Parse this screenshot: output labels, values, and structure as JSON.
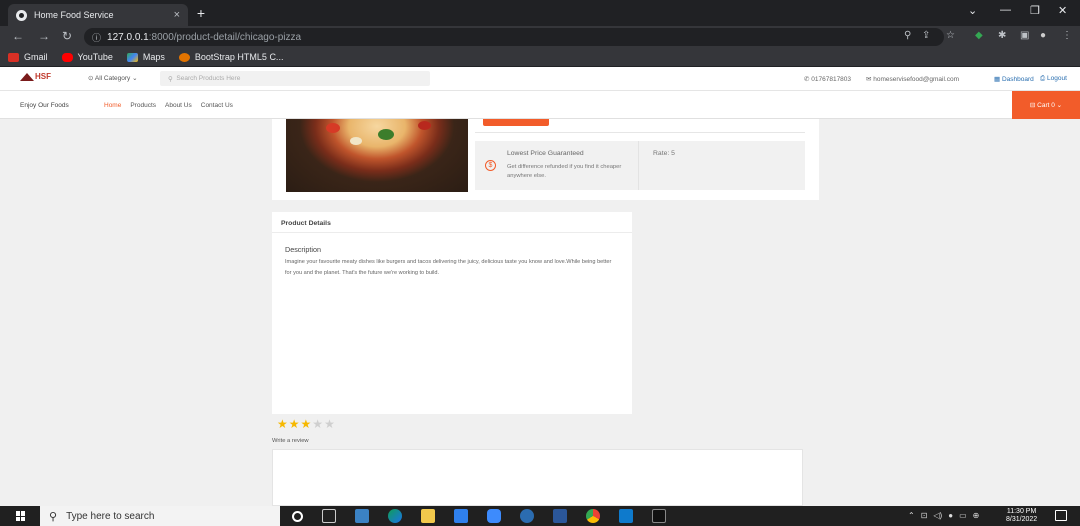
{
  "browser": {
    "tab_title": "Home Food Service",
    "tab_close": "×",
    "new_tab": "+",
    "url_host": "127.0.0.1",
    "url_rest": ":8000/product-detail/chicago-pizza",
    "bookmarks": [
      "Gmail",
      "YouTube",
      "Maps",
      "BootStrap HTML5 C..."
    ]
  },
  "site": {
    "logo_text": "HSF",
    "category_label": "All Category",
    "search_placeholder": "Search Products Here",
    "phone": "01767817803",
    "email": "homeservisefood@gmail.com",
    "dashboard": "Dashboard",
    "logout": "Logout",
    "tagline": "Enjoy Our Foods",
    "nav": [
      "Home",
      "Products",
      "About Us",
      "Contact Us"
    ],
    "cart": "Cart 0"
  },
  "product": {
    "guarantee_title": "Lowest Price Guaranteed",
    "guarantee_text": "Get difference refunded if you find it cheaper anywhere else.",
    "rate": "Rate: 5",
    "details_heading": "Product Details",
    "description_title": "Description",
    "description": "Imagine your favourite meaty dishes like burgers and tacos delivering the juicy, delicious taste you know and love.While being better for you and the planet. That's the future we're working to build.",
    "rating_value": 3,
    "rating_max": 5,
    "review_label": "Write a review"
  },
  "taskbar": {
    "search_placeholder": "Type here to search",
    "time": "11:30 PM",
    "date": "8/31/2022"
  }
}
